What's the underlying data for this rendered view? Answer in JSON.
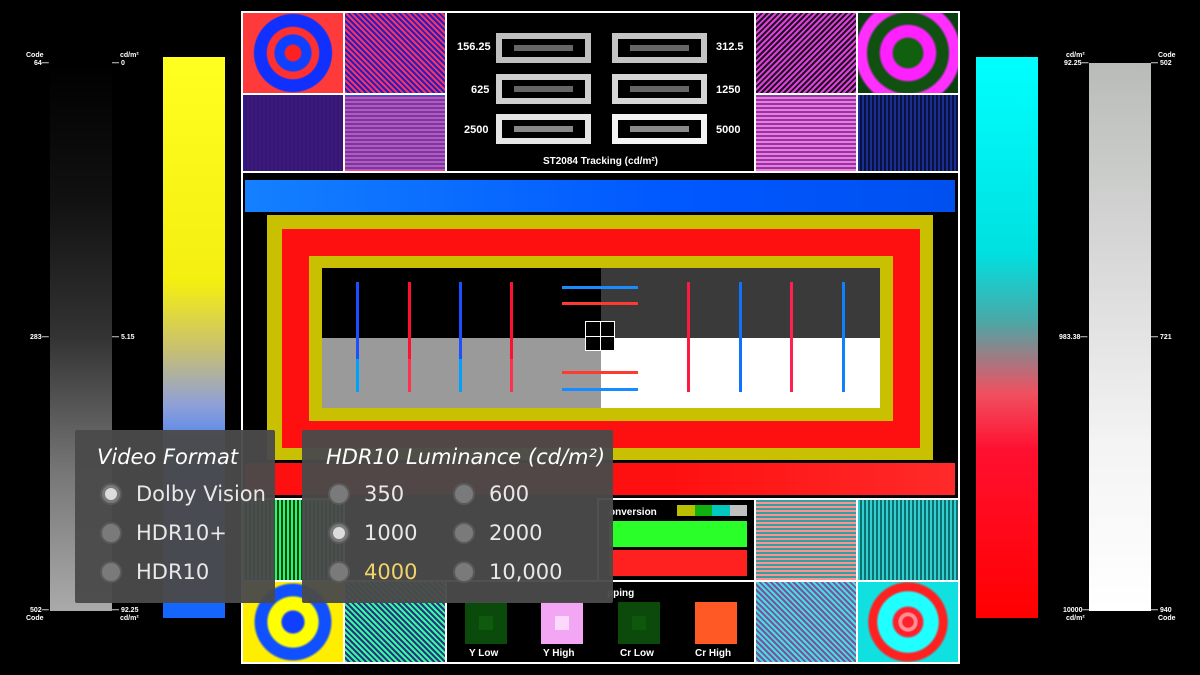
{
  "left_scale": {
    "code_header": "Code",
    "unit_header": "cd/m²",
    "top": {
      "code": "64",
      "value": "0"
    },
    "mid": {
      "code": "283",
      "value": "5.15"
    },
    "bottom": {
      "code": "502",
      "value": "92.25"
    },
    "bottom_code_label": "Code",
    "bottom_unit_label": "cd/m²"
  },
  "right_scale": {
    "unit_header": "cd/m²",
    "code_header": "Code",
    "top": {
      "value": "92.25",
      "code": "502"
    },
    "mid": {
      "value": "983.38",
      "code": "721"
    },
    "bottom": {
      "value": "10000",
      "code": "940"
    },
    "bottom_unit_label": "cd/m²",
    "bottom_code_label": "Code"
  },
  "tracking": {
    "title": "ST2084 Tracking (cd/m²)",
    "left_labels": [
      "156.25",
      "625",
      "2500"
    ],
    "right_labels": [
      "312.5",
      "1250",
      "5000"
    ]
  },
  "partial_labels": {
    "conversion": "onversion",
    "clipping": "pping"
  },
  "clip_boxes": [
    {
      "label": "Y Low",
      "outer": "#0a4a0a",
      "inner": "#0f5a0f"
    },
    {
      "label": "Y High",
      "outer": "#f3a6f3",
      "inner": "#fdd8fd"
    },
    {
      "label": "Cr Low",
      "outer": "#0c4a0c",
      "inner": "#0e580e"
    },
    {
      "label": "Cr High",
      "outer": "#ff5a26",
      "inner": "#ff6a30"
    }
  ],
  "video_format_panel": {
    "title": "Video Format",
    "options": [
      {
        "label": "Dolby Vision",
        "selected": true
      },
      {
        "label": "HDR10+",
        "selected": false
      },
      {
        "label": "HDR10",
        "selected": false
      }
    ]
  },
  "luminance_panel": {
    "title": "HDR10 Luminance (cd/m²)",
    "options": [
      {
        "label": "350",
        "selected": false,
        "highlighted": false
      },
      {
        "label": "600",
        "selected": false,
        "highlighted": false
      },
      {
        "label": "1000",
        "selected": true,
        "highlighted": false
      },
      {
        "label": "2000",
        "selected": false,
        "highlighted": false
      },
      {
        "label": "4000",
        "selected": false,
        "highlighted": true
      },
      {
        "label": "10,000",
        "selected": false,
        "highlighted": false
      }
    ]
  },
  "colors": {
    "highlight_text": "#f0d36a",
    "red": "#ff1010",
    "yellow": "#c8c000",
    "blue": "#1060ff"
  }
}
